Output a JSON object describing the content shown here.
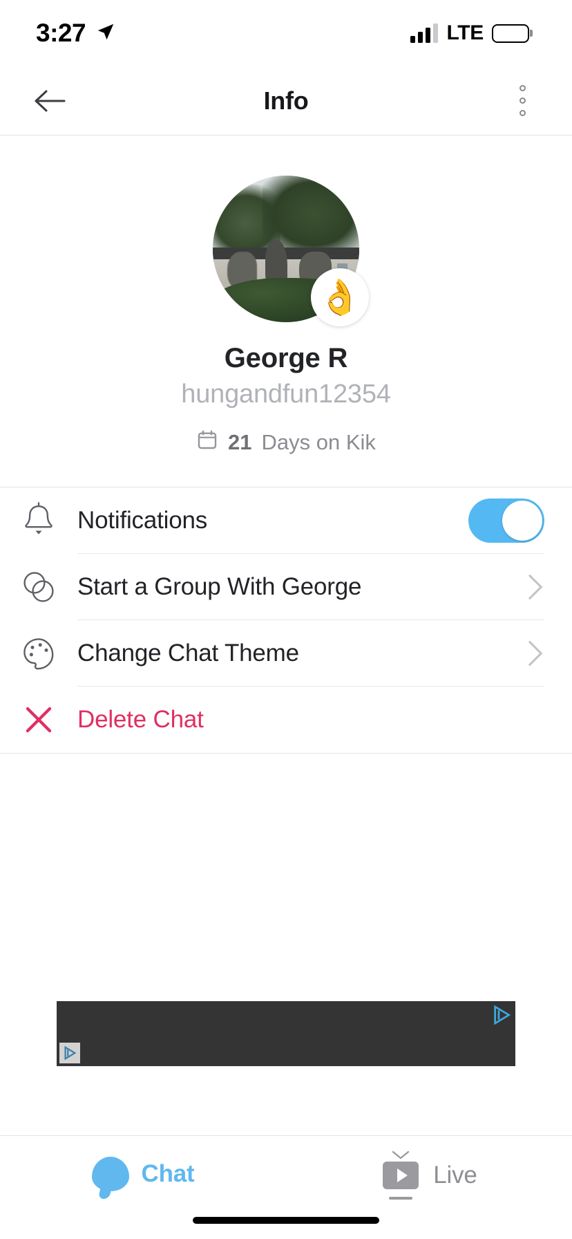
{
  "status_bar": {
    "time": "3:27",
    "location_icon": "location-arrow-icon",
    "signal_icon": "cellular-signal-icon",
    "signal_bars_filled": 3,
    "signal_bars_total": 4,
    "network": "LTE",
    "battery_icon": "battery-low-power-icon",
    "battery_color": "#f5c842"
  },
  "nav": {
    "back_icon": "back-arrow-icon",
    "title": "Info",
    "more_icon": "more-vertical-icon"
  },
  "profile": {
    "avatar_alt": "profile-photo-chinese-garden",
    "status_emoji": "👌",
    "status_emoji_name": "ok-hand-emoji",
    "display_name": "George R",
    "username": "hungandfun12354",
    "calendar_icon": "calendar-icon",
    "days_count": "21",
    "days_label": "Days on Kik"
  },
  "menu": {
    "items": [
      {
        "id": "notifications",
        "icon": "bell-icon",
        "label": "Notifications",
        "control": "toggle",
        "toggle_on": true,
        "accent": "#54b9f2"
      },
      {
        "id": "start-group",
        "icon": "group-circles-icon",
        "label": "Start a Group With George",
        "control": "chevron"
      },
      {
        "id": "change-theme",
        "icon": "palette-icon",
        "label": "Change Chat Theme",
        "control": "chevron"
      },
      {
        "id": "delete-chat",
        "icon": "close-x-icon",
        "label": "Delete Chat",
        "control": "none",
        "danger_color": "#e02f62"
      }
    ]
  },
  "ad": {
    "adchoices_icon": "adchoices-icon",
    "background_color": "#343434"
  },
  "tabbar": {
    "tabs": [
      {
        "id": "chat",
        "icon": "chat-bubble-icon",
        "label": "Chat",
        "active": true,
        "color": "#60b8ef"
      },
      {
        "id": "live",
        "icon": "live-tv-icon",
        "label": "Live",
        "active": false,
        "color": "#8e8e93"
      }
    ]
  }
}
